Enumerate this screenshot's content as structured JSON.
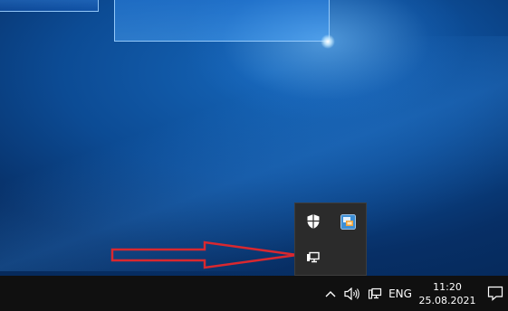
{
  "tray_overflow": {
    "icons": [
      "windows-security-shield-icon",
      "network-app-icon",
      "network-monitor-icon"
    ]
  },
  "taskbar": {
    "icons": [
      "chevron-up-icon",
      "speaker-volume-icon",
      "network-monitor-icon",
      "action-center-icon"
    ],
    "language": "ENG",
    "time": "11:20",
    "date": "25.08.2021"
  },
  "annotation": {
    "color": "#d9282f",
    "shape": "arrow-right"
  }
}
